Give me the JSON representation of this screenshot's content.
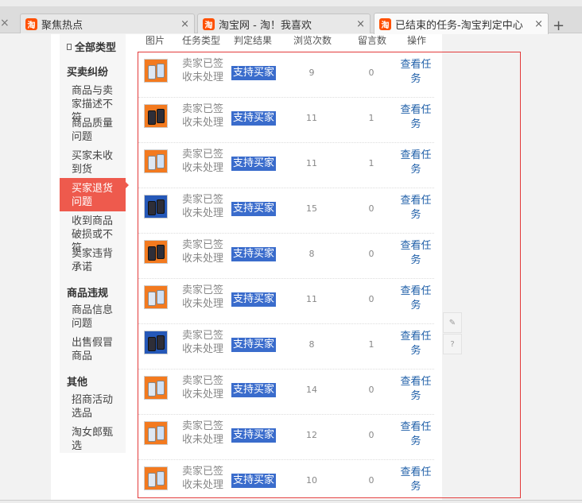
{
  "browser": {
    "tabs": [
      {
        "label": "聚焦热点",
        "favicon": "淘"
      },
      {
        "label": "淘宝网 - 淘！我喜欢",
        "favicon": "淘"
      },
      {
        "label": "已结束的任务-淘宝判定中心",
        "favicon": "淘",
        "active": true
      }
    ],
    "close_glyph": "×",
    "newtab_glyph": "+"
  },
  "sidebar": {
    "header": "全部类型",
    "groups": [
      {
        "title": "买卖纠纷",
        "items": [
          "商品与卖家描述不符",
          "商品质量问题",
          "买家未收到货",
          "买家退货问题",
          "收到商品破损或不符",
          "卖家违背承诺"
        ]
      },
      {
        "title": "商品违规",
        "items": [
          "商品信息问题",
          "出售假冒商品"
        ]
      },
      {
        "title": "其他",
        "items": [
          "招商活动选品",
          "淘女郎甄选"
        ]
      }
    ],
    "active_item": "买家退货问题"
  },
  "table": {
    "headers": [
      "图片",
      "任务类型",
      "判定结果",
      "浏览次数",
      "留言数",
      "操作"
    ],
    "rows": [
      {
        "type": "卖家已签收未处理",
        "result": "支持买家",
        "views": "9",
        "messages": "0",
        "action": "查看任务",
        "thumb": "orange"
      },
      {
        "type": "卖家已签收未处理",
        "result": "支持买家",
        "views": "11",
        "messages": "1",
        "action": "查看任务",
        "thumb": "orange-dark"
      },
      {
        "type": "卖家已签收未处理",
        "result": "支持买家",
        "views": "11",
        "messages": "1",
        "action": "查看任务",
        "thumb": "orange"
      },
      {
        "type": "卖家已签收未处理",
        "result": "支持买家",
        "views": "15",
        "messages": "0",
        "action": "查看任务",
        "thumb": "blue-dark"
      },
      {
        "type": "卖家已签收未处理",
        "result": "支持买家",
        "views": "8",
        "messages": "0",
        "action": "查看任务",
        "thumb": "orange-dark"
      },
      {
        "type": "卖家已签收未处理",
        "result": "支持买家",
        "views": "11",
        "messages": "0",
        "action": "查看任务",
        "thumb": "orange"
      },
      {
        "type": "卖家已签收未处理",
        "result": "支持买家",
        "views": "8",
        "messages": "1",
        "action": "查看任务",
        "thumb": "blue-dark"
      },
      {
        "type": "卖家已签收未处理",
        "result": "支持买家",
        "views": "14",
        "messages": "0",
        "action": "查看任务",
        "thumb": "orange"
      },
      {
        "type": "卖家已签收未处理",
        "result": "支持买家",
        "views": "12",
        "messages": "0",
        "action": "查看任务",
        "thumb": "orange"
      },
      {
        "type": "卖家已签收未处理",
        "result": "支持买家",
        "views": "10",
        "messages": "0",
        "action": "查看任务",
        "thumb": "orange"
      }
    ]
  },
  "floating_tools": [
    {
      "icon": "pencil-icon",
      "glyph": "✎"
    },
    {
      "icon": "help-icon",
      "glyph": "?"
    }
  ],
  "colors": {
    "accent_red": "#ee5a4d",
    "highlight_blue": "#3a6ccc",
    "link_blue": "#1f5fa8",
    "selection_border": "#e23a3a",
    "taobao_orange": "#ff5000"
  }
}
